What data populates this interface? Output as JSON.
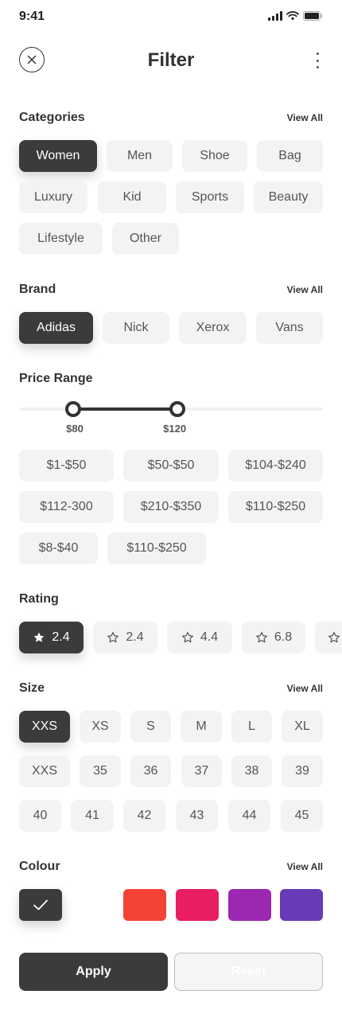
{
  "status_bar": {
    "time": "9:41",
    "icons": [
      "signal-icon",
      "wifi-icon",
      "battery-icon"
    ]
  },
  "header": {
    "title": "Filter",
    "close_icon": "close-icon",
    "more_icon": "more-vertical-icon"
  },
  "categories": {
    "title": "Categories",
    "view_all": "View All",
    "items": [
      "Women",
      "Men",
      "Shoe",
      "Bag",
      "Luxury",
      "Kid",
      "Sports",
      "Beauty",
      "Lifestyle",
      "Other"
    ],
    "selected": "Women"
  },
  "brand": {
    "title": "Brand",
    "view_all": "View All",
    "items": [
      "Adidas",
      "Nick",
      "Xerox",
      "Vans"
    ],
    "selected": "Adidas"
  },
  "price": {
    "title": "Price Range",
    "min_label": "$80",
    "max_label": "$120",
    "range_fraction": [
      0.178,
      0.52
    ],
    "presets": [
      "$1-$50",
      "$50-$50",
      "$104-$240",
      "$112-300",
      "$210-$350",
      "$110-$250",
      "$8-$40",
      "$110-$250"
    ]
  },
  "rating": {
    "title": "Rating",
    "items": [
      "2.4",
      "2.4",
      "4.4",
      "6.8"
    ],
    "selected_index": 0,
    "icon": "star-icon"
  },
  "size": {
    "title": "Size",
    "view_all": "View All",
    "items": [
      "XXS",
      "XS",
      "S",
      "M",
      "L",
      "XL",
      "XXS",
      "35",
      "36",
      "37",
      "38",
      "39",
      "40",
      "41",
      "42",
      "43",
      "44",
      "45"
    ],
    "selected_index": 0
  },
  "colour": {
    "title": "Colour",
    "view_all": "View All",
    "swatches": [
      "#3b3b3b",
      "#ffffff",
      "#f44336",
      "#e91e63",
      "#9c27b0",
      "#673ab7"
    ],
    "selected_index": 0,
    "check_icon": "check-icon"
  },
  "actions": {
    "apply": "Apply",
    "reset": "Reset"
  }
}
